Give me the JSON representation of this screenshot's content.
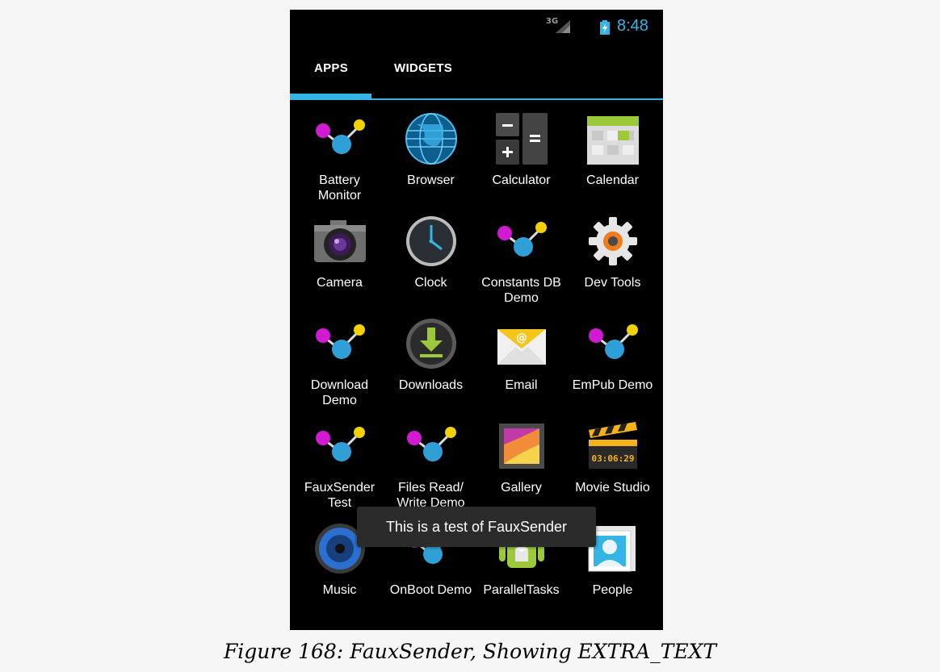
{
  "status_bar": {
    "network": "3G",
    "time": "8:48"
  },
  "tabs": [
    {
      "label": "APPS"
    },
    {
      "label": "WIDGETS"
    }
  ],
  "apps": [
    {
      "label": "Battery\nMonitor",
      "icon": "molecule-icon"
    },
    {
      "label": "Browser",
      "icon": "globe-icon"
    },
    {
      "label": "Calculator",
      "icon": "calculator-icon"
    },
    {
      "label": "Calendar",
      "icon": "calendar-icon"
    },
    {
      "label": "Camera",
      "icon": "camera-icon"
    },
    {
      "label": "Clock",
      "icon": "clock-icon"
    },
    {
      "label": "Constants DB\nDemo",
      "icon": "molecule-icon"
    },
    {
      "label": "Dev Tools",
      "icon": "gear-icon"
    },
    {
      "label": "Download\nDemo",
      "icon": "molecule-icon"
    },
    {
      "label": "Downloads",
      "icon": "download-icon"
    },
    {
      "label": "Email",
      "icon": "envelope-icon"
    },
    {
      "label": "EmPub Demo",
      "icon": "molecule-icon"
    },
    {
      "label": "FauxSender\nTest",
      "icon": "molecule-icon"
    },
    {
      "label": "Files Read/\nWrite Demo",
      "icon": "molecule-icon"
    },
    {
      "label": "Gallery",
      "icon": "gallery-icon"
    },
    {
      "label": "Movie Studio",
      "icon": "clapperboard-icon"
    },
    {
      "label": "Music",
      "icon": "speaker-icon"
    },
    {
      "label": "OnBoot Demo",
      "icon": "molecule-icon"
    },
    {
      "label": "ParallelTasks",
      "icon": "android-icon"
    },
    {
      "label": "People",
      "icon": "contact-card-icon"
    }
  ],
  "movie_studio_counter": "03:06:29",
  "toast": {
    "text": "This is a test of FauxSender"
  },
  "caption": "Figure 168: FauxSender, Showing EXTRA_TEXT",
  "colors": {
    "accent": "#33b5e5",
    "background": "#000000"
  }
}
